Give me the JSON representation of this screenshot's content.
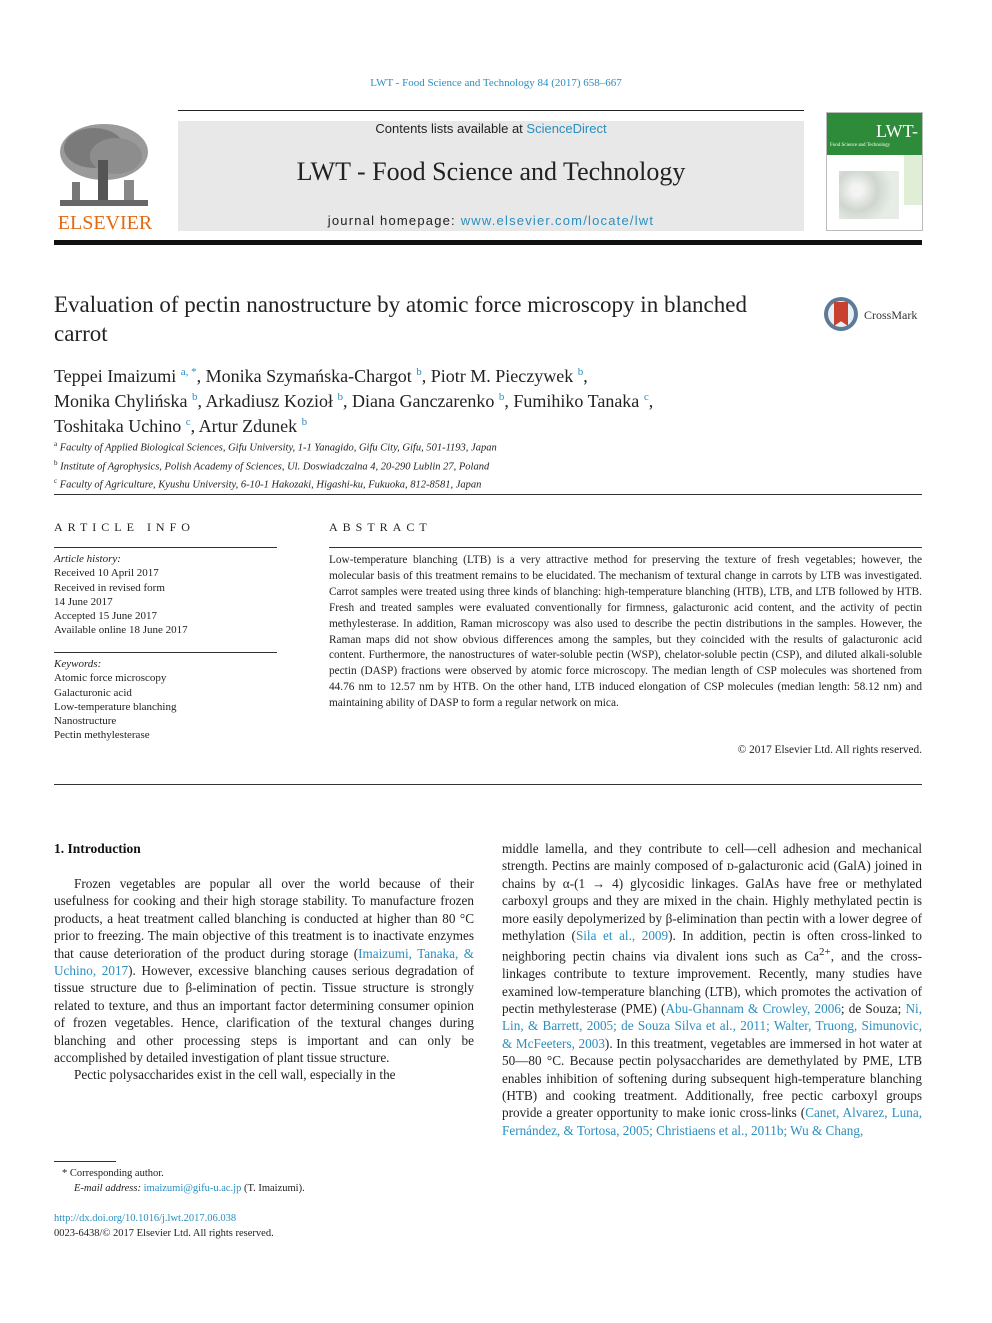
{
  "running_header": "LWT - Food Science and Technology 84 (2017) 658–667",
  "publisher": {
    "logo_text": "ELSEVIER",
    "logo_icon": "elsevier-tree-icon"
  },
  "banner": {
    "contents_prefix": "Contents lists available at ",
    "contents_link": "ScienceDirect",
    "journal_title": "LWT - Food Science and Technology",
    "homepage_prefix": "journal homepage: ",
    "homepage_link": "www.elsevier.com/locate/lwt"
  },
  "cover": {
    "title": "LWT-",
    "subtitle": "Food Science and Technology",
    "icon": "journal-cover-thumbnail"
  },
  "article": {
    "title": "Evaluation of pectin nanostructure by atomic force microscopy in blanched carrot",
    "crossmark_label": "CrossMark",
    "authors": [
      {
        "name": "Teppei Imaizumi",
        "sup": "a, *"
      },
      {
        "name": "Monika Szymańska-Chargot",
        "sup": "b"
      },
      {
        "name": "Piotr M. Pieczywek",
        "sup": "b"
      },
      {
        "name": "Monika Chylińska",
        "sup": "b"
      },
      {
        "name": "Arkadiusz Kozioł",
        "sup": "b"
      },
      {
        "name": "Diana Ganczarenko",
        "sup": "b"
      },
      {
        "name": "Fumihiko Tanaka",
        "sup": "c"
      },
      {
        "name": "Toshitaka Uchino",
        "sup": "c"
      },
      {
        "name": "Artur Zdunek",
        "sup": "b"
      }
    ],
    "affiliations": [
      {
        "key": "a",
        "text": "Faculty of Applied Biological Sciences, Gifu University, 1-1 Yanagido, Gifu City, Gifu, 501-1193, Japan"
      },
      {
        "key": "b",
        "text": "Institute of Agrophysics, Polish Academy of Sciences, Ul. Doswiadczalna 4, 20-290 Lublin 27, Poland"
      },
      {
        "key": "c",
        "text": "Faculty of Agriculture, Kyushu University, 6-10-1 Hakozaki, Higashi-ku, Fukuoka, 812-8581, Japan"
      }
    ]
  },
  "article_info": {
    "heading": "ARTICLE INFO",
    "history_label": "Article history:",
    "history": [
      "Received 10 April 2017",
      "Received in revised form",
      "14 June 2017",
      "Accepted 15 June 2017",
      "Available online 18 June 2017"
    ],
    "keywords_label": "Keywords:",
    "keywords": [
      "Atomic force microscopy",
      "Galacturonic acid",
      "Low-temperature blanching",
      "Nanostructure",
      "Pectin methylesterase"
    ]
  },
  "abstract": {
    "heading": "ABSTRACT",
    "text": "Low-temperature blanching (LTB) is a very attractive method for preserving the texture of fresh vegetables; however, the molecular basis of this treatment remains to be elucidated. The mechanism of textural change in carrots by LTB was investigated. Carrot samples were treated using three kinds of blanching: high-temperature blanching (HTB), LTB, and LTB followed by HTB. Fresh and treated samples were evaluated conventionally for firmness, galacturonic acid content, and the activity of pectin methylesterase. In addition, Raman microscopy was also used to describe the pectin distributions in the samples. However, the Raman maps did not show obvious differences among the samples, but they coincided with the results of galacturonic acid content. Furthermore, the nanostructures of water-soluble pectin (WSP), chelator-soluble pectin (CSP), and diluted alkali-soluble pectin (DASP) fractions were observed by atomic force microscopy. The median length of CSP molecules was shortened from 44.76 nm to 12.57 nm by HTB. On the other hand, LTB induced elongation of CSP molecules (median length: 58.12 nm) and maintaining ability of DASP to form a regular network on mica.",
    "copyright": "© 2017 Elsevier Ltd. All rights reserved."
  },
  "introduction": {
    "heading": "1.  Introduction",
    "p1_a": "Frozen vegetables are popular all over the world because of their usefulness for cooking and their high storage stability. To manufacture frozen products, a heat treatment called blanching is conducted at higher than 80 °C prior to freezing. The main objective of this treatment is to inactivate enzymes that cause deterioration of the product during storage (",
    "p1_cite": "Imaizumi, Tanaka, & Uchino, 2017",
    "p1_b": "). However, excessive blanching causes serious degradation of tissue structure due to β-elimination of pectin. Tissue structure is strongly related to texture, and thus an important factor determining consumer opinion of frozen vegetables. Hence, clarification of the textural changes during blanching and other processing steps is important and can only be accomplished by detailed investigation of plant tissue structure.",
    "p2_start": "Pectic polysaccharides exist in the cell wall, especially in the",
    "right_a": "middle lamella, and they contribute to cell—cell adhesion and mechanical strength. Pectins are mainly composed of ᴅ-galacturonic acid (GalA) joined in chains by α-(1 → 4) glycosidic linkages. GalAs have free or methylated carboxyl groups and they are mixed in the chain. Highly methylated pectin is more easily depolymerized by β-elimination than pectin with a lower degree of methylation (",
    "right_cite1": "Sila et al., 2009",
    "right_b": "). In addition, pectin is often cross-linked to neighboring pectin chains via divalent ions such as Ca",
    "right_sup": "2+",
    "right_c": ", and the cross-linkages contribute to texture improvement. Recently, many studies have examined low-temperature blanching (LTB), which promotes the activation of pectin methylesterase (PME) (",
    "right_cite2": "Abu-Ghannam & Crowley, 2006",
    "right_d": "; de Souza; ",
    "right_cite3": "Ni, Lin, & Barrett, 2005; de Souza Silva et al., 2011; Walter, Truong, Simunovic, & McFeeters, 2003",
    "right_e": "). In this treatment, vegetables are immersed in hot water at 50—80 °C. Because pectin polysaccharides are demethylated by PME, LTB enables inhibition of softening during subsequent high-temperature blanching (HTB) and cooking treatment. Additionally, free pectic carboxyl groups provide a greater opportunity to make ionic cross-links (",
    "right_cite4": "Canet, Alvarez, Luna, Fernández, & Tortosa, 2005; Christiaens et al., 2011b; Wu & Chang,"
  },
  "footnote": {
    "corresponding": "* Corresponding author.",
    "email_label": "E-mail address: ",
    "email": "imaizumi@gifu-u.ac.jp",
    "email_suffix": " (T. Imaizumi).",
    "doi": "http://dx.doi.org/10.1016/j.lwt.2017.06.038",
    "issn_copyright": "0023-6438/© 2017 Elsevier Ltd. All rights reserved."
  },
  "colors": {
    "link": "#2a8fc0",
    "elsevier_orange": "#e36a12",
    "banner_bg": "#e8e8e8",
    "cover_green": "#2e8b3a"
  }
}
